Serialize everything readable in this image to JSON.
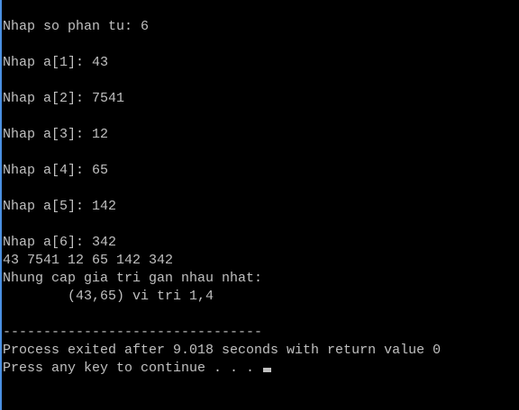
{
  "console": {
    "lines": [
      "Nhap so phan tu: 6",
      "",
      "Nhap a[1]: 43",
      "",
      "Nhap a[2]: 7541",
      "",
      "Nhap a[3]: 12",
      "",
      "Nhap a[4]: 65",
      "",
      "Nhap a[5]: 142",
      "",
      "Nhap a[6]: 342",
      "43 7541 12 65 142 342",
      "Nhung cap gia tri gan nhau nhat:",
      "        (43,65) vi tri 1,4",
      "",
      "--------------------------------",
      "Process exited after 9.018 seconds with return value 0",
      "Press any key to continue . . . "
    ]
  },
  "colors": {
    "background": "#000000",
    "text": "#c0c0c0",
    "window_edge": "#4a90e2"
  }
}
